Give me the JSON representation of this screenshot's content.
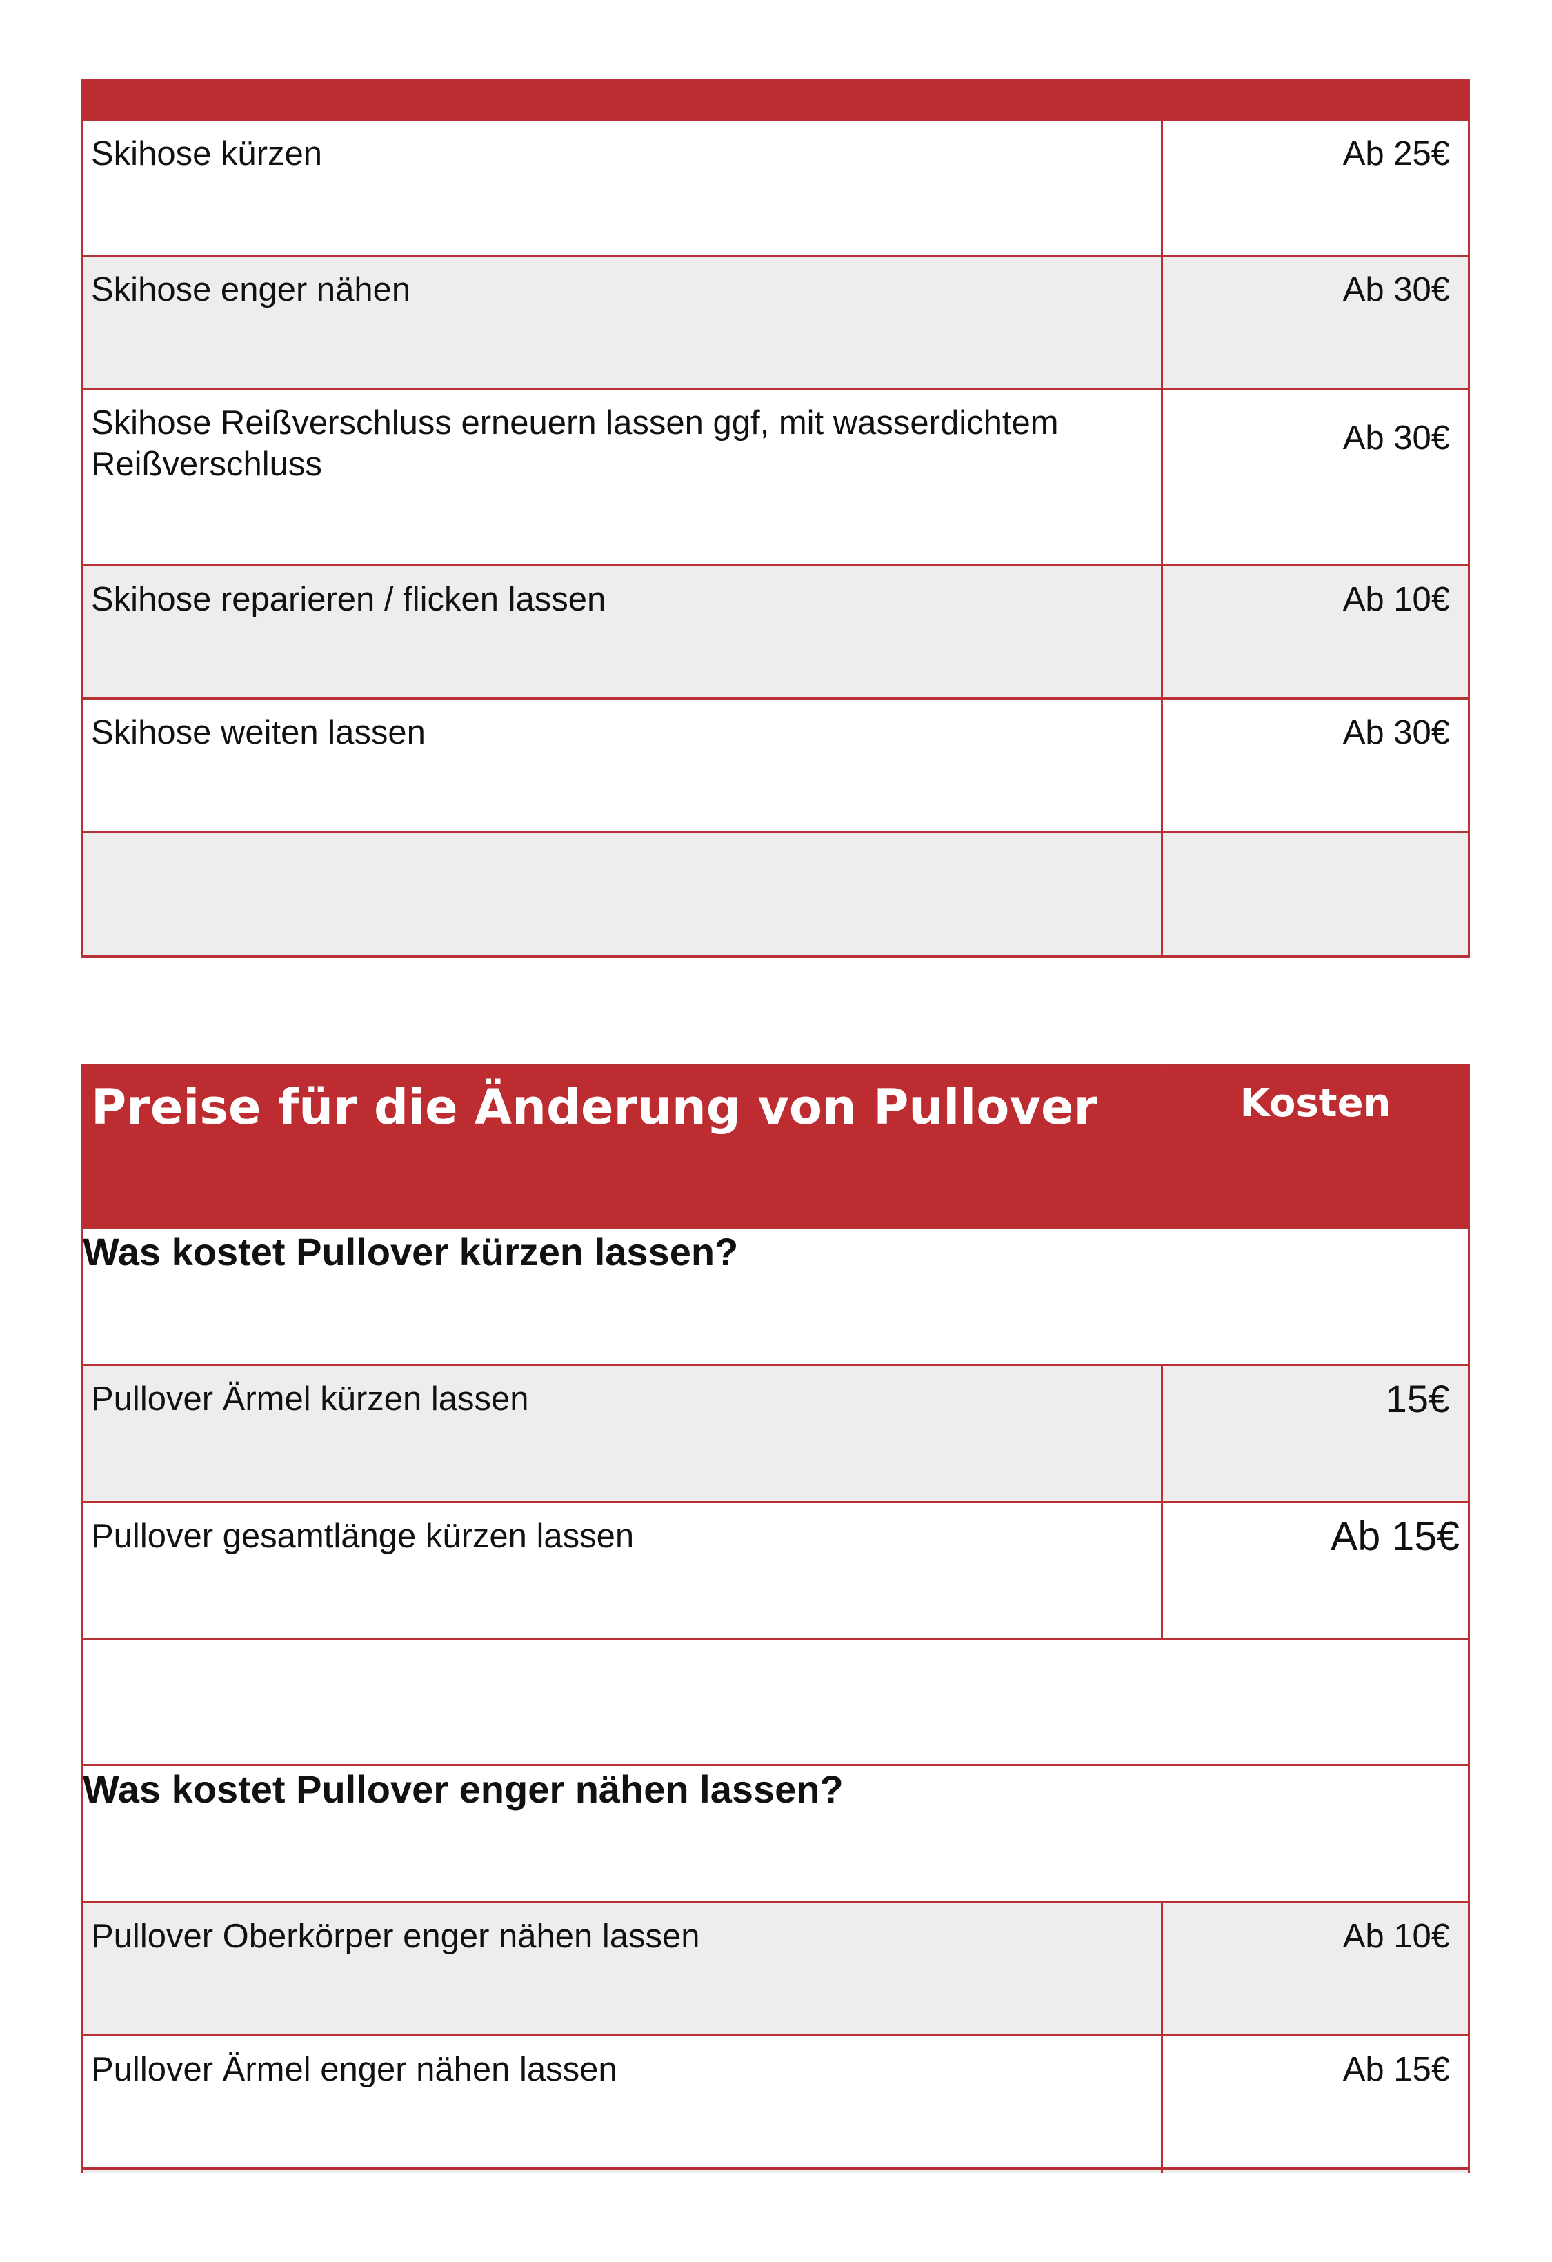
{
  "table1": {
    "rows": [
      {
        "desc": "Skihose kürzen",
        "cost": "Ab 25€"
      },
      {
        "desc": "Skihose enger nähen",
        "cost": "Ab 30€"
      },
      {
        "desc": "Skihose Reißverschluss erneuern lassen ggf, mit wasserdichtem Reißverschluss",
        "cost": "Ab 30€"
      },
      {
        "desc": "Skihose reparieren / flicken lassen",
        "cost": "Ab 10€"
      },
      {
        "desc": "Skihose weiten lassen",
        "cost": "Ab 30€"
      },
      {
        "desc": "",
        "cost": ""
      }
    ]
  },
  "table2": {
    "title": "Preise für die Änderung von Pullover",
    "cost_header": "Kosten",
    "q1": "Was kostet Pullover kürzen lassen?",
    "q1_rows": [
      {
        "desc": "Pullover Ärmel kürzen lassen",
        "cost": "15€"
      },
      {
        "desc": "Pullover gesamtlänge kürzen lassen",
        "cost": "Ab 15€"
      }
    ],
    "q2": "Was kostet Pullover enger nähen lassen?",
    "q2_rows": [
      {
        "desc": "Pullover Oberkörper enger nähen lassen",
        "cost": "Ab 10€"
      },
      {
        "desc": "Pullover Ärmel enger nähen lassen",
        "cost": "Ab 15€"
      }
    ]
  },
  "colors": {
    "header_red": "#bd2c30",
    "border_red": "#b83235",
    "row_grey": "#ededed"
  }
}
